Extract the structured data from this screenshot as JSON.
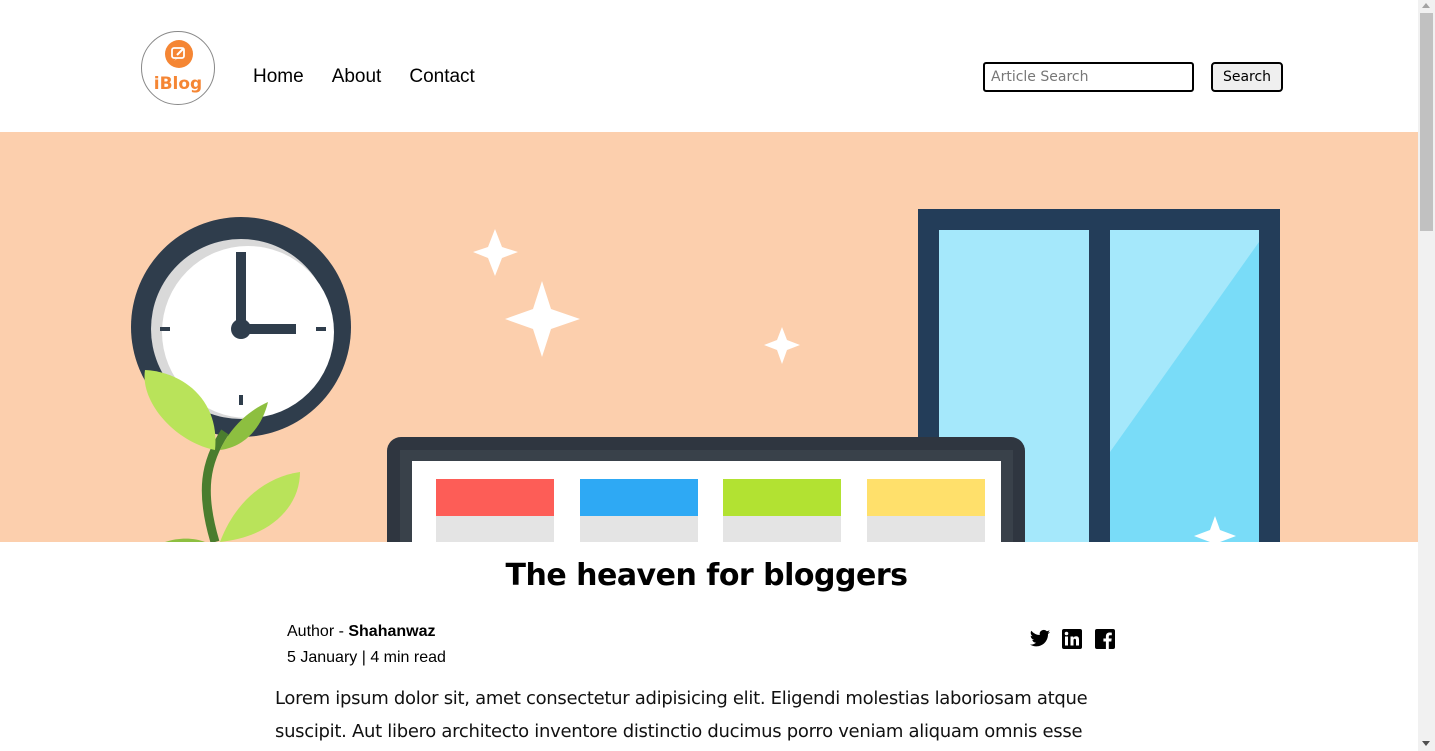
{
  "brand": {
    "logo_text": "iBlog",
    "accent": "#f58634"
  },
  "nav": {
    "items": [
      {
        "label": "Home"
      },
      {
        "label": "About"
      },
      {
        "label": "Contact"
      }
    ]
  },
  "search": {
    "placeholder": "Article Search",
    "value": "",
    "button_label": "Search"
  },
  "hero": {
    "background": "#fccfad",
    "illustration": [
      "clock-icon",
      "plant-icon",
      "sparkle-icon",
      "window-icon",
      "monitor-icon"
    ]
  },
  "article": {
    "title": "The heaven for bloggers",
    "author_label": "Author - ",
    "author_name": "Shahanwaz",
    "date_line": "5 January | 4 min read",
    "body": "Lorem ipsum dolor sit, amet consectetur adipisicing elit. Eligendi molestias laboriosam atque suscipit. Aut libero architecto inventore distinctio ducimus porro veniam aliquam omnis esse nostrum sequi"
  },
  "social": [
    {
      "icon": "twitter-icon"
    },
    {
      "icon": "linkedin-icon"
    },
    {
      "icon": "facebook-icon"
    }
  ]
}
